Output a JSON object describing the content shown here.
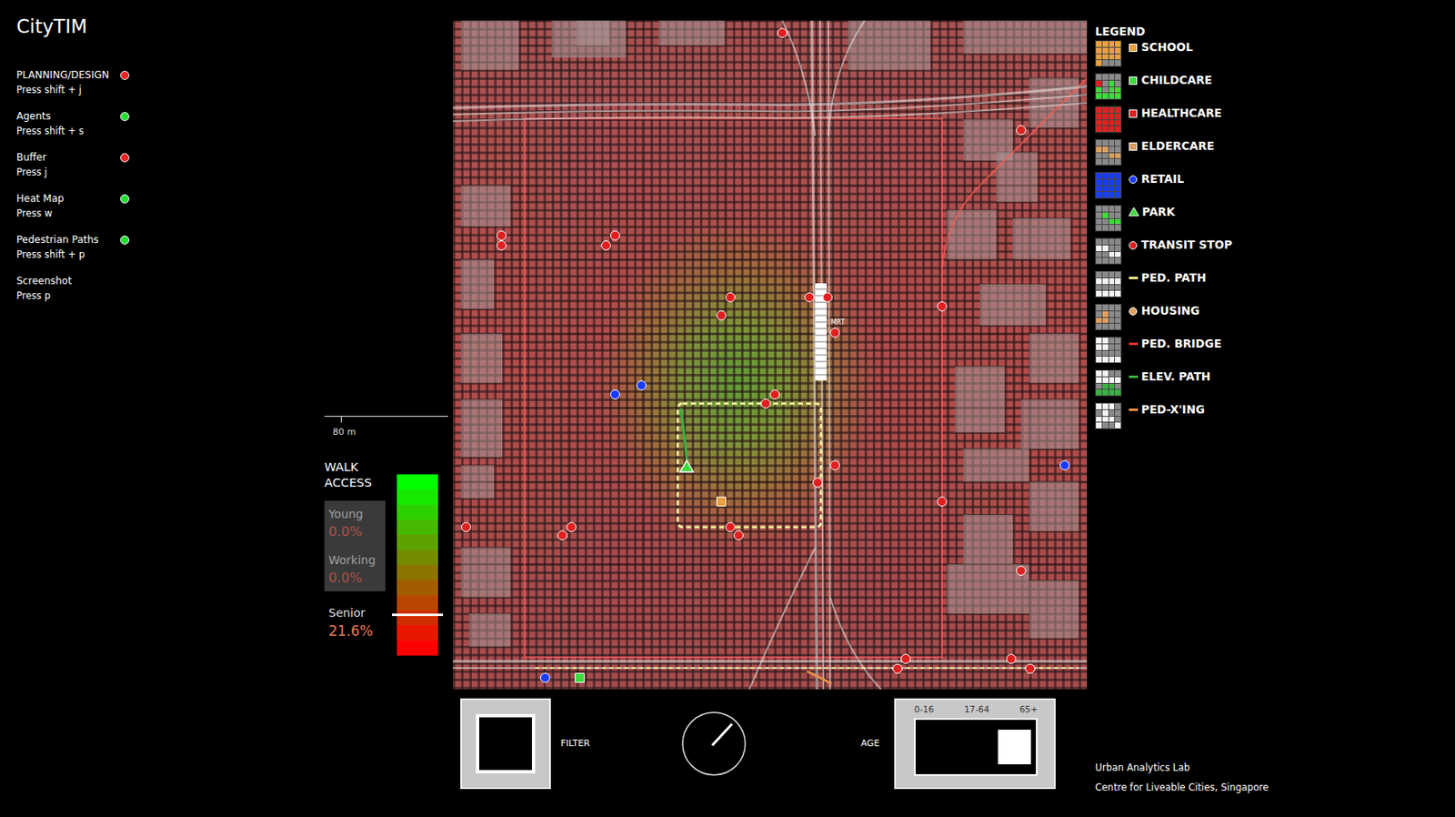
{
  "app": {
    "title": "CityTIM"
  },
  "menu": [
    {
      "label": "PLANNING/DESIGN",
      "hint": "Press shift + j",
      "kind": "toggle",
      "on": false
    },
    {
      "label": "Agents",
      "hint": "Press shift + s",
      "kind": "toggle",
      "on": true
    },
    {
      "label": "Buffer",
      "hint": "Press j",
      "kind": "toggle",
      "on": false
    },
    {
      "label": "Heat Map",
      "hint": "Press w",
      "kind": "toggle",
      "on": true
    },
    {
      "label": "Pedestrian Paths",
      "hint": "Press shift + p",
      "kind": "toggle",
      "on": true
    },
    {
      "label": "Screenshot",
      "hint": "Press p",
      "kind": "action",
      "on": false
    }
  ],
  "scale": {
    "label": "80 m"
  },
  "walk_access": {
    "title": "WALK ACCESS",
    "level": 0.216,
    "groups": [
      {
        "label": "Young",
        "value": "0.0%",
        "selected": false
      },
      {
        "label": "Working",
        "value": "0.0%",
        "selected": false
      },
      {
        "label": "Senior",
        "value": "21.6%",
        "selected": true
      }
    ]
  },
  "map": {
    "station_label": "MRT"
  },
  "legend": {
    "title": "LEGEND",
    "items": [
      {
        "label": "SCHOOL",
        "kind": "square",
        "color": "#e8a040"
      },
      {
        "label": "CHILDCARE",
        "kind": "square",
        "color": "#3ddc3d"
      },
      {
        "label": "HEALTHCARE",
        "kind": "square",
        "color": "#e02020"
      },
      {
        "label": "ELDERCARE",
        "kind": "square",
        "color": "#d9a060"
      },
      {
        "label": "RETAIL",
        "kind": "circle",
        "color": "#1a3cff"
      },
      {
        "label": "PARK",
        "kind": "triangle",
        "color": "#3ddc3d"
      },
      {
        "label": "TRANSIT STOP",
        "kind": "circle",
        "color": "#e02020"
      },
      {
        "label": "PED. PATH",
        "kind": "line",
        "color": "#f0e68c"
      },
      {
        "label": "HOUSING",
        "kind": "circle",
        "color": "#e0a060"
      },
      {
        "label": "PED. BRIDGE",
        "kind": "line",
        "color": "#e03030"
      },
      {
        "label": "ELEV. PATH",
        "kind": "line",
        "color": "#3cb043"
      },
      {
        "label": "PED-X'ING",
        "kind": "line",
        "color": "#e8904a"
      }
    ]
  },
  "filter": {
    "label": "FILTER"
  },
  "age": {
    "label": "AGE",
    "ticks": [
      {
        "label": "0-16",
        "selected": false
      },
      {
        "label": "17-64",
        "selected": false
      },
      {
        "label": "65+",
        "selected": true
      }
    ]
  },
  "credits": [
    "Urban Analytics Lab",
    "Centre for Liveable Cities, Singapore"
  ]
}
